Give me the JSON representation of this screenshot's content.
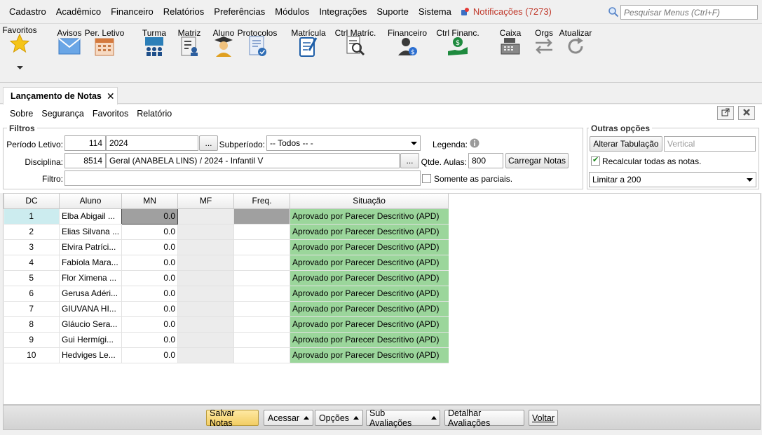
{
  "menu": {
    "items": [
      "Cadastro",
      "Acadêmico",
      "Financeiro",
      "Relatórios",
      "Preferências",
      "Módulos",
      "Integrações",
      "Suporte",
      "Sistema"
    ],
    "notifications": "Notificações (7273)",
    "search_placeholder": "Pesquisar Menus (Ctrl+F)"
  },
  "toolbar": {
    "favoritos": "Favoritos",
    "avisos": "Avisos",
    "per_letivo": "Per. Letivo",
    "turma": "Turma",
    "matriz": "Matriz",
    "aluno": "Aluno",
    "protocolos": "Protocolos",
    "matricula": "Matrícula",
    "ctrl_matric": "Ctrl Matríc.",
    "financeiro": "Financeiro",
    "ctrl_financ": "Ctrl Financ.",
    "caixa": "Caixa",
    "orgs": "Orgs",
    "atualizar": "Atualizar"
  },
  "tab": {
    "title": "Lançamento de Notas",
    "close": "✕"
  },
  "submenu": [
    "Sobre",
    "Segurança",
    "Favoritos",
    "Relatório"
  ],
  "filtros": {
    "legend": "Filtros",
    "periodo_label": "Período Letivo:",
    "periodo_code": "114",
    "periodo_value": "2024",
    "browse": "...",
    "subperiodo_label": "Subperíodo:",
    "subperiodo_value": "-- Todos -- -",
    "legenda_label": "Legenda:",
    "disciplina_label": "Disciplina:",
    "disciplina_code": "8514",
    "disciplina_value": "Geral (ANABELA LINS) / 2024 - Infantil V",
    "qtde_label": "Qtde. Aulas:",
    "qtde_value": "800",
    "carregar": "Carregar Notas",
    "filtro_label": "Filtro:",
    "filtro_value": "",
    "somente_parciais": "Somente as parciais."
  },
  "outras": {
    "legend": "Outras opções",
    "alterar_tabulacao": "Alterar Tabulação",
    "tabulacao_placeholder": "Vertical",
    "recalcular": "Recalcular todas as notas.",
    "recalcular_checked": true,
    "limitar": "Limitar a 200"
  },
  "grid": {
    "headers": [
      "DC",
      "Aluno",
      "MN",
      "MF",
      "Freq.",
      "Situação"
    ],
    "rows": [
      {
        "dc": "1",
        "aluno": "Elba Abigail ...",
        "mn": "0.0",
        "mf": "",
        "freq": "",
        "situacao": "Aprovado por Parecer Descritivo (APD)"
      },
      {
        "dc": "2",
        "aluno": "Elias Silvana ...",
        "mn": "0.0",
        "mf": "",
        "freq": "",
        "situacao": "Aprovado por Parecer Descritivo (APD)"
      },
      {
        "dc": "3",
        "aluno": "Elvira Patríci...",
        "mn": "0.0",
        "mf": "",
        "freq": "",
        "situacao": "Aprovado por Parecer Descritivo (APD)"
      },
      {
        "dc": "4",
        "aluno": "Fabíola Mara...",
        "mn": "0.0",
        "mf": "",
        "freq": "",
        "situacao": "Aprovado por Parecer Descritivo (APD)"
      },
      {
        "dc": "5",
        "aluno": "Flor Ximena ...",
        "mn": "0.0",
        "mf": "",
        "freq": "",
        "situacao": "Aprovado por Parecer Descritivo (APD)"
      },
      {
        "dc": "6",
        "aluno": "Gerusa Adéri...",
        "mn": "0.0",
        "mf": "",
        "freq": "",
        "situacao": "Aprovado por Parecer Descritivo (APD)"
      },
      {
        "dc": "7",
        "aluno": "GIUVANA HI...",
        "mn": "0.0",
        "mf": "",
        "freq": "",
        "situacao": "Aprovado por Parecer Descritivo (APD)"
      },
      {
        "dc": "8",
        "aluno": "Gláucio Sera...",
        "mn": "0.0",
        "mf": "",
        "freq": "",
        "situacao": "Aprovado por Parecer Descritivo (APD)"
      },
      {
        "dc": "9",
        "aluno": "Gui Hermígi...",
        "mn": "0.0",
        "mf": "",
        "freq": "",
        "situacao": "Aprovado por Parecer Descritivo (APD)"
      },
      {
        "dc": "10",
        "aluno": "Hedviges Le...",
        "mn": "0.0",
        "mf": "",
        "freq": "",
        "situacao": "Aprovado por Parecer Descritivo (APD)"
      }
    ]
  },
  "bottom": {
    "salvar": "Salvar Notas",
    "acessar": "Acessar",
    "opcoes": "Opções",
    "sub_avaliacoes": "Sub Avaliações",
    "detalhar": "Detalhar Avaliações",
    "voltar": "Voltar"
  },
  "colors": {
    "situacao_bg": "#9bd69b",
    "notification_text": "#c0392b",
    "selected_row": "#ccecef",
    "primary_button": "#f2cd63"
  }
}
